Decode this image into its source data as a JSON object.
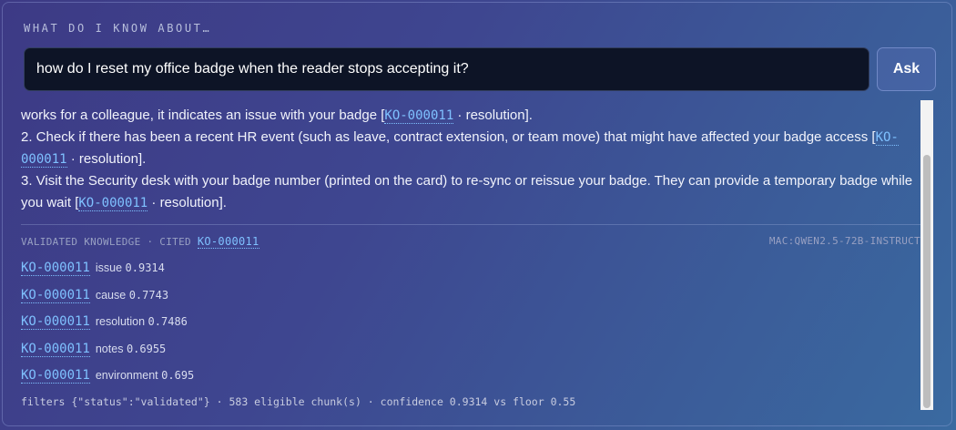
{
  "header": {
    "label": "WHAT DO I KNOW ABOUT…"
  },
  "search": {
    "value": "how do I reset my office badge when the reader stops accepting it?",
    "ask_label": "Ask"
  },
  "answer": {
    "line1": {
      "text": "works for a colleague, it indicates an issue with your badge [",
      "ref": "KO-000011",
      "suffix": " · resolution]."
    },
    "item2": {
      "text": "2. Check if there has been a recent HR event (such as leave, contract extension, or team move) that might have affected your badge access [",
      "ref": "KO-000011",
      "suffix": " · resolution]."
    },
    "item3": {
      "text": "3. Visit the Security desk with your badge number (printed on the card) to re-sync or reissue your badge. They can provide a temporary badge while you wait [",
      "ref": "KO-000011",
      "suffix": " · resolution]."
    }
  },
  "meta": {
    "label": "VALIDATED KNOWLEDGE · CITED ",
    "cited_ref": "KO-000011",
    "model": "MAC:QWEN2.5-72B-INSTRUCT"
  },
  "chunks": [
    {
      "ref": "KO-000011",
      "field": "issue",
      "score": "0.9314"
    },
    {
      "ref": "KO-000011",
      "field": "cause",
      "score": "0.7743"
    },
    {
      "ref": "KO-000011",
      "field": "resolution",
      "score": "0.7486"
    },
    {
      "ref": "KO-000011",
      "field": "notes",
      "score": "0.6955"
    },
    {
      "ref": "KO-000011",
      "field": "environment",
      "score": "0.695"
    }
  ],
  "filters": "filters {\"status\":\"validated\"} · 583 eligible chunk(s) · confidence 0.9314 vs floor 0.55"
}
